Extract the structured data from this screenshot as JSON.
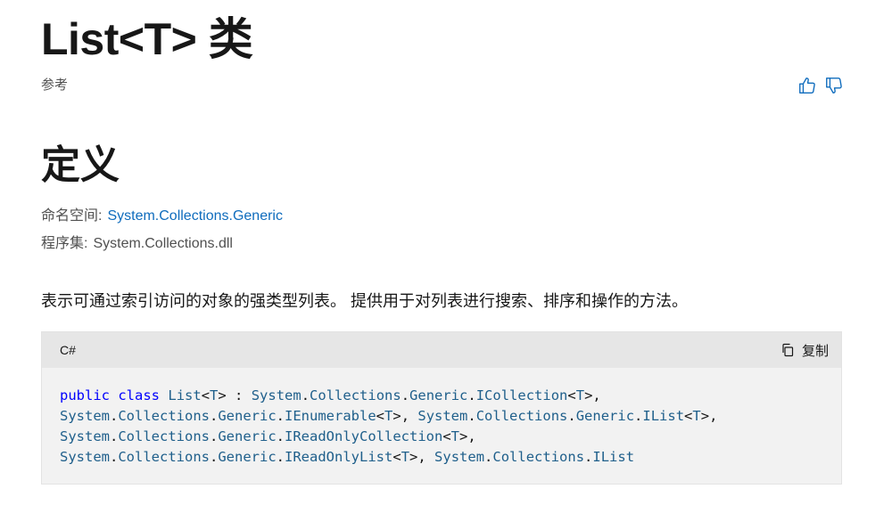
{
  "header": {
    "title": "List<T> 类",
    "subtitle": "参考"
  },
  "feedback": {
    "thumbs_up_icon": "thumbs-up-icon",
    "thumbs_down_icon": "thumbs-down-icon",
    "accent_color": "#0f6cbd"
  },
  "definition": {
    "heading": "定义",
    "namespace_label": "命名空间:",
    "namespace_value": "System.Collections.Generic",
    "assembly_label": "程序集:",
    "assembly_value": "System.Collections.dll"
  },
  "summary": "表示可通过索引访问的对象的强类型列表。 提供用于对列表进行搜索、排序和操作的方法。",
  "code": {
    "language": "C#",
    "copy_label": "复制",
    "copy_icon": "copy-icon",
    "lines": [
      [
        {
          "t": "kw",
          "v": "public"
        },
        {
          "t": "pl",
          "v": " "
        },
        {
          "t": "kw",
          "v": "class"
        },
        {
          "t": "pl",
          "v": " "
        },
        {
          "t": "ns",
          "v": "List"
        },
        {
          "t": "pl",
          "v": "<"
        },
        {
          "t": "ns",
          "v": "T"
        },
        {
          "t": "pl",
          "v": "> : "
        },
        {
          "t": "ns",
          "v": "System"
        },
        {
          "t": "pl",
          "v": "."
        },
        {
          "t": "ns",
          "v": "Collections"
        },
        {
          "t": "pl",
          "v": "."
        },
        {
          "t": "ns",
          "v": "Generic"
        },
        {
          "t": "pl",
          "v": "."
        },
        {
          "t": "ns",
          "v": "ICollection"
        },
        {
          "t": "pl",
          "v": "<"
        },
        {
          "t": "ns",
          "v": "T"
        },
        {
          "t": "pl",
          "v": ">,"
        }
      ],
      [
        {
          "t": "ns",
          "v": "System"
        },
        {
          "t": "pl",
          "v": "."
        },
        {
          "t": "ns",
          "v": "Collections"
        },
        {
          "t": "pl",
          "v": "."
        },
        {
          "t": "ns",
          "v": "Generic"
        },
        {
          "t": "pl",
          "v": "."
        },
        {
          "t": "ns",
          "v": "IEnumerable"
        },
        {
          "t": "pl",
          "v": "<"
        },
        {
          "t": "ns",
          "v": "T"
        },
        {
          "t": "pl",
          "v": ">, "
        },
        {
          "t": "ns",
          "v": "System"
        },
        {
          "t": "pl",
          "v": "."
        },
        {
          "t": "ns",
          "v": "Collections"
        },
        {
          "t": "pl",
          "v": "."
        },
        {
          "t": "ns",
          "v": "Generic"
        },
        {
          "t": "pl",
          "v": "."
        },
        {
          "t": "ns",
          "v": "IList"
        },
        {
          "t": "pl",
          "v": "<"
        },
        {
          "t": "ns",
          "v": "T"
        },
        {
          "t": "pl",
          "v": ">,"
        }
      ],
      [
        {
          "t": "ns",
          "v": "System"
        },
        {
          "t": "pl",
          "v": "."
        },
        {
          "t": "ns",
          "v": "Collections"
        },
        {
          "t": "pl",
          "v": "."
        },
        {
          "t": "ns",
          "v": "Generic"
        },
        {
          "t": "pl",
          "v": "."
        },
        {
          "t": "ns",
          "v": "IReadOnlyCollection"
        },
        {
          "t": "pl",
          "v": "<"
        },
        {
          "t": "ns",
          "v": "T"
        },
        {
          "t": "pl",
          "v": ">,"
        }
      ],
      [
        {
          "t": "ns",
          "v": "System"
        },
        {
          "t": "pl",
          "v": "."
        },
        {
          "t": "ns",
          "v": "Collections"
        },
        {
          "t": "pl",
          "v": "."
        },
        {
          "t": "ns",
          "v": "Generic"
        },
        {
          "t": "pl",
          "v": "."
        },
        {
          "t": "ns",
          "v": "IReadOnlyList"
        },
        {
          "t": "pl",
          "v": "<"
        },
        {
          "t": "ns",
          "v": "T"
        },
        {
          "t": "pl",
          "v": ">, "
        },
        {
          "t": "ns",
          "v": "System"
        },
        {
          "t": "pl",
          "v": "."
        },
        {
          "t": "ns",
          "v": "Collections"
        },
        {
          "t": "pl",
          "v": "."
        },
        {
          "t": "ns",
          "v": "IList"
        }
      ]
    ]
  }
}
